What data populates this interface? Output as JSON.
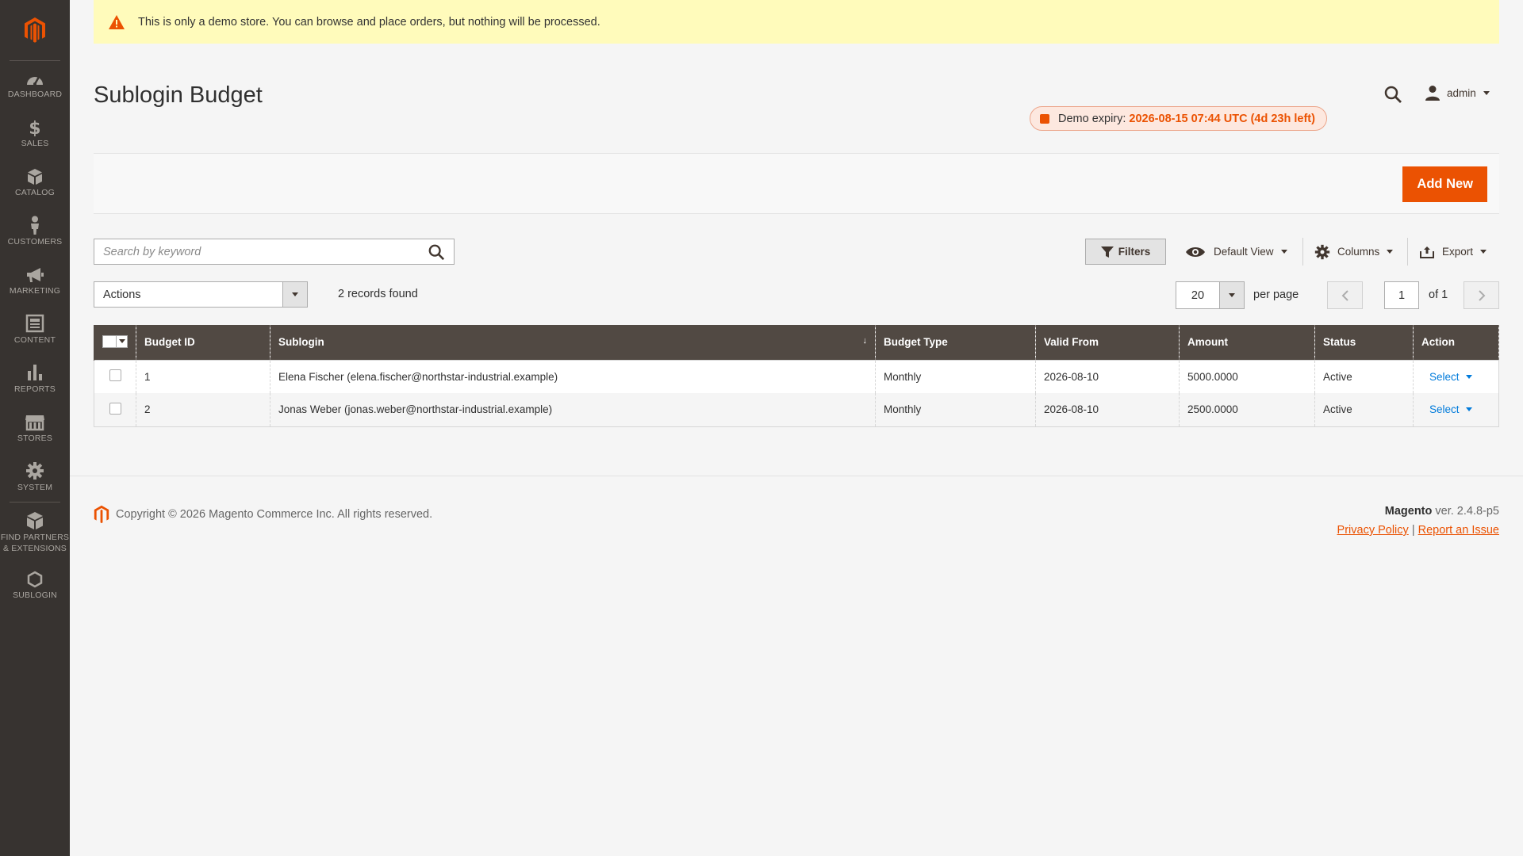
{
  "notice": {
    "text": "This is only a demo store. You can browse and place orders, but nothing will be processed."
  },
  "sidebar": {
    "items": [
      {
        "label": "DASHBOARD",
        "icon": "dashboard-icon"
      },
      {
        "label": "SALES",
        "icon": "dollar-icon"
      },
      {
        "label": "CATALOG",
        "icon": "box-icon"
      },
      {
        "label": "CUSTOMERS",
        "icon": "customer-icon"
      },
      {
        "label": "MARKETING",
        "icon": "megaphone-icon"
      },
      {
        "label": "CONTENT",
        "icon": "content-icon"
      },
      {
        "label": "REPORTS",
        "icon": "bar-chart-icon"
      },
      {
        "label": "STORES",
        "icon": "store-icon"
      },
      {
        "label": "SYSTEM",
        "icon": "gear-icon"
      },
      {
        "label_line1": "FIND PARTNERS",
        "label_line2": "& EXTENSIONS",
        "icon": "partners-icon"
      },
      {
        "label": "SUBLOGIN",
        "icon": "hexagon-icon"
      }
    ]
  },
  "header": {
    "title": "Sublogin Budget",
    "user": "admin",
    "expiry_label": "Demo expiry:",
    "expiry_value": "2026-08-15 07:44 UTC (4d 23h left)"
  },
  "actions_bar": {
    "add_new": "Add New"
  },
  "toolbar": {
    "search_placeholder": "Search by keyword",
    "filters": "Filters",
    "view": "Default View",
    "columns": "Columns",
    "export": "Export",
    "mass_action": "Actions",
    "records_found": "2 records found",
    "per_page_value": "20",
    "per_page_label": "per page",
    "page_value": "1",
    "page_of": "of 1"
  },
  "grid": {
    "columns": [
      "Budget ID",
      "Sublogin",
      "Budget Type",
      "Valid From",
      "Amount",
      "Status",
      "Action"
    ],
    "sort_indicator": "↓",
    "rows": [
      {
        "id": "1",
        "sublogin": "Elena Fischer (elena.fischer@northstar-industrial.example)",
        "type": "Monthly",
        "valid_from": "2026-08-10",
        "amount": "5000.0000",
        "status": "Active",
        "action": "Select"
      },
      {
        "id": "2",
        "sublogin": "Jonas Weber (jonas.weber@northstar-industrial.example)",
        "type": "Monthly",
        "valid_from": "2026-08-10",
        "amount": "2500.0000",
        "status": "Active",
        "action": "Select"
      }
    ]
  },
  "footer": {
    "copyright": "Copyright © 2026 Magento Commerce Inc. All rights reserved.",
    "brand": "Magento",
    "version": " ver. 2.4.8-p5",
    "privacy": "Privacy Policy",
    "separator": "|",
    "report": "Report an Issue"
  },
  "colors": {
    "accent": "#eb5202",
    "sidebar": "#373330",
    "grid_header": "#514943",
    "link": "#007bdb",
    "notice_bg": "#fffbbb"
  }
}
